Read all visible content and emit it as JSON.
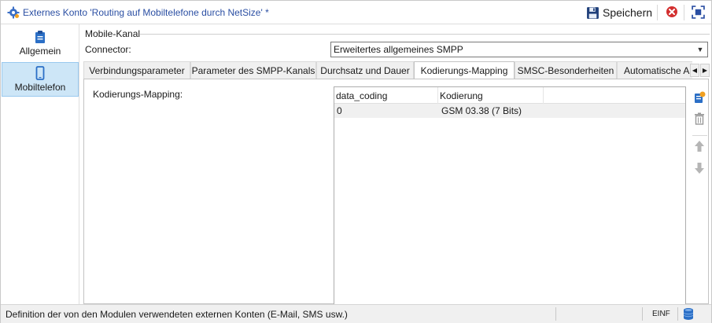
{
  "window": {
    "title": "Externes Konto 'Routing auf Mobiltelefone durch NetSize' *",
    "save_label": "Speichern"
  },
  "sidebar": {
    "items": [
      {
        "label": "Allgemein",
        "icon": "clipboard-icon",
        "selected": false
      },
      {
        "label": "Mobiltelefon",
        "icon": "mobile-phone-icon",
        "selected": true
      }
    ]
  },
  "main": {
    "group_title": "Mobile-Kanal",
    "connector_label": "Connector:",
    "connector_value": "Erweitertes allgemeines SMPP",
    "tabs": [
      {
        "label": "Verbindungsparameter"
      },
      {
        "label": "Parameter des SMPP-Kanals"
      },
      {
        "label": "Durchsatz und Dauer"
      },
      {
        "label": "Kodierungs-Mapping",
        "active": true
      },
      {
        "label": "SMSC-Besonderheiten"
      },
      {
        "label": "Automatische A"
      }
    ],
    "mapping_label": "Kodierungs-Mapping:",
    "grid": {
      "columns": [
        "data_coding",
        "Kodierung"
      ],
      "rows": [
        {
          "data_coding": "0",
          "kodierung": "GSM 03.38 (7 Bits)"
        }
      ]
    }
  },
  "statusbar": {
    "text": "Definition der von den Modulen verwendeten externen Konten (E-Mail, SMS usw.)",
    "mode": "EINF"
  },
  "colors": {
    "accent": "#2b4fa3",
    "selection": "#cde6f7",
    "close_red": "#d32f2f"
  }
}
